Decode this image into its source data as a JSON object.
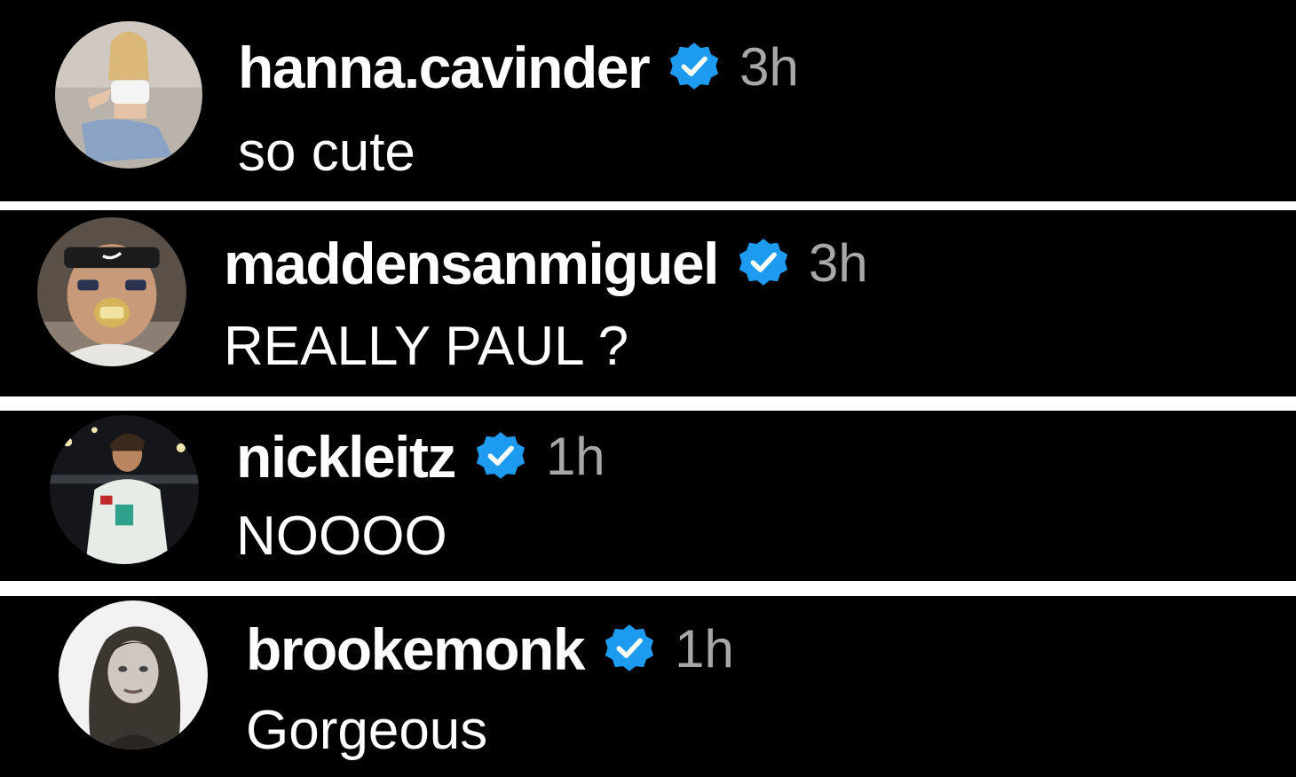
{
  "comments": [
    {
      "username": "hanna.cavinder",
      "verified": true,
      "time": "3h",
      "text": "so cute",
      "avatar": "avatar-photo"
    },
    {
      "username": "maddensanmiguel",
      "verified": true,
      "time": "3h",
      "text": "REALLY PAUL ?",
      "avatar": "avatar-photo"
    },
    {
      "username": "nickleitz",
      "verified": true,
      "time": "1h",
      "text": "NOOOO",
      "avatar": "avatar-photo"
    },
    {
      "username": "brookemonk",
      "verified": true,
      "time": "1h",
      "text": "Gorgeous",
      "avatar": "avatar-photo"
    }
  ],
  "colors": {
    "background": "#000000",
    "separator": "#ffffff",
    "username": "#ffffff",
    "timestamp": "#a8a8a8",
    "verified_badge": "#1d9bf0"
  },
  "icons": {
    "verified": "verified-badge-icon"
  }
}
